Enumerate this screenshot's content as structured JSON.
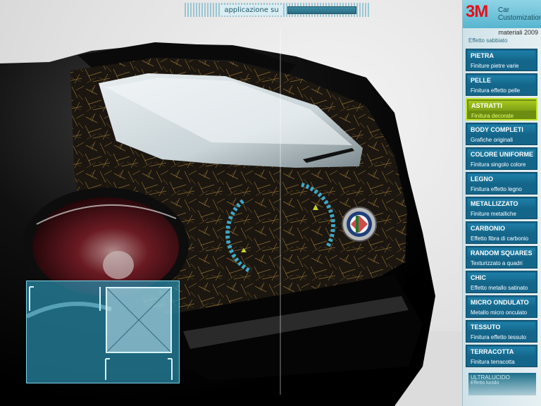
{
  "topbar": {
    "label": "applicazione su",
    "progress": 1.0
  },
  "brand": {
    "logo": "3M",
    "line1": "Car",
    "line2": "Customization",
    "subtitle": "materiali 2009"
  },
  "materials": {
    "cut_top": "Effetto sabbiato",
    "items": [
      {
        "title": "PIETRA",
        "subtitle": "Finiture pietre varie"
      },
      {
        "title": "PELLE",
        "subtitle": "Finitura effetto pelle"
      },
      {
        "title": "ASTRATTI",
        "subtitle": "Finitura decorate",
        "selected": true
      },
      {
        "title": "BODY COMPLETI",
        "subtitle": "Grafiche originali"
      },
      {
        "title": "COLORE UNIFORME",
        "subtitle": "Finitura singolo colore"
      },
      {
        "title": "LEGNO",
        "subtitle": "Finitura effetto legno"
      },
      {
        "title": "METALLIZZATO",
        "subtitle": "Finiture metalliche"
      },
      {
        "title": "CARBONIO",
        "subtitle": "Effetto fibra di carbonio"
      },
      {
        "title": "RANDOM SQUARES",
        "subtitle": "Texturizzato a quadri"
      },
      {
        "title": "CHIC",
        "subtitle": "Effetto metallo satinato"
      },
      {
        "title": "MICRO ONDULATO",
        "subtitle": "Metallo micro onculato"
      },
      {
        "title": "TESSUTO",
        "subtitle": "Finitura effetto tessuto"
      },
      {
        "title": "TERRACOTTA",
        "subtitle": "Finitura terracotta"
      }
    ],
    "cut_bottom_title": "ULTRALUCIDO",
    "cut_bottom_sub": "Effetto lucido"
  },
  "colors": {
    "panel_item": "#14658a",
    "selected_item": "#a7c71f",
    "brand_red": "#e2121b"
  }
}
